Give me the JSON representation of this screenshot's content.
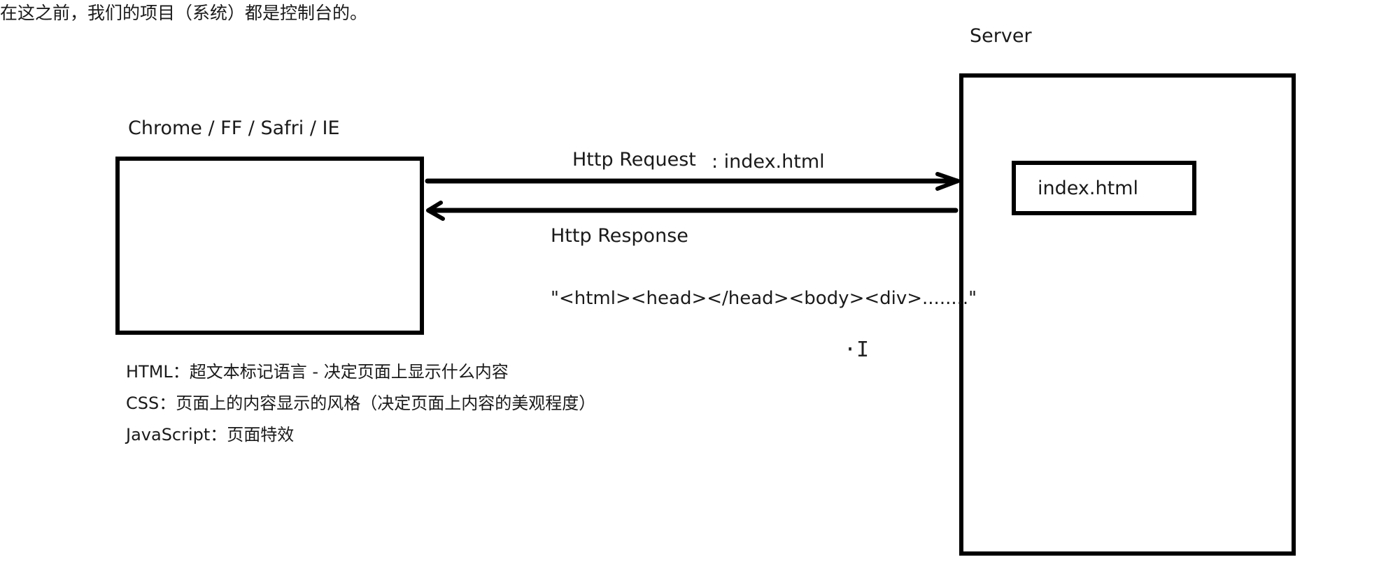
{
  "header_note": "在这之前，我们的项目（系统）都是控制台的。",
  "client": {
    "label": "Chrome / FF / Safri / IE"
  },
  "server": {
    "label": "Server",
    "file_label": "index.html"
  },
  "request": {
    "label": "Http Request",
    "target": ": index.html"
  },
  "response": {
    "label": "Http Response",
    "body_text": "\"<html><head></head><body><div>........\""
  },
  "definitions": [
    {
      "text": "HTML：超文本标记语言 - 决定页面上显示什么内容"
    },
    {
      "text": "CSS：页面上的内容显示的风格（决定页面上内容的美观程度）"
    },
    {
      "text": "JavaScript：页面特效"
    }
  ],
  "cursor_icon": "text-cursor-icon"
}
